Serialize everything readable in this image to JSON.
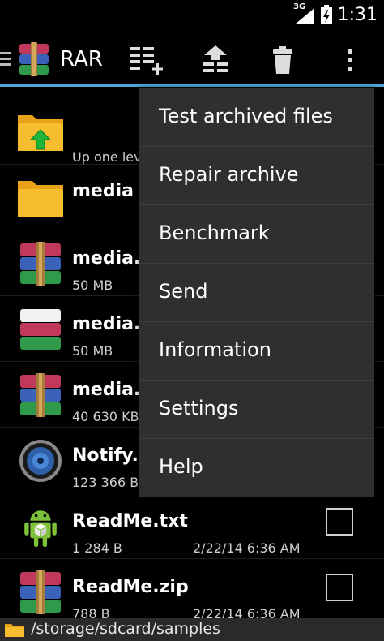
{
  "status": {
    "network": "3G",
    "time": "1:31"
  },
  "actionbar": {
    "title": "RAR",
    "actions": [
      "add-to-archive-icon",
      "up-icon",
      "delete-icon",
      "overflow-icon"
    ],
    "accent": "#4aa8d8"
  },
  "files": [
    {
      "name": "",
      "sub": "Up one level",
      "type": "up"
    },
    {
      "name": "media",
      "type": "folder"
    },
    {
      "name": "media.p",
      "size": "50 MB",
      "type": "rar"
    },
    {
      "name": "media.p",
      "size": "50 MB",
      "type": "rar-part"
    },
    {
      "name": "media.p",
      "size": "40 630 KB",
      "type": "rar"
    },
    {
      "name": "Notify.m",
      "size": "123 366 B",
      "type": "audio"
    },
    {
      "name": "ReadMe.txt",
      "size": "1 284 B",
      "date": "2/22/14 6:36 AM",
      "type": "android"
    },
    {
      "name": "ReadMe.zip",
      "size": "788 B",
      "date": "2/22/14 6:36 AM",
      "type": "rar"
    }
  ],
  "footer": {
    "path": "/storage/sdcard/samples"
  },
  "menu": {
    "items": [
      "Test archived files",
      "Repair archive",
      "Benchmark",
      "Send",
      "Information",
      "Settings",
      "Help"
    ]
  }
}
